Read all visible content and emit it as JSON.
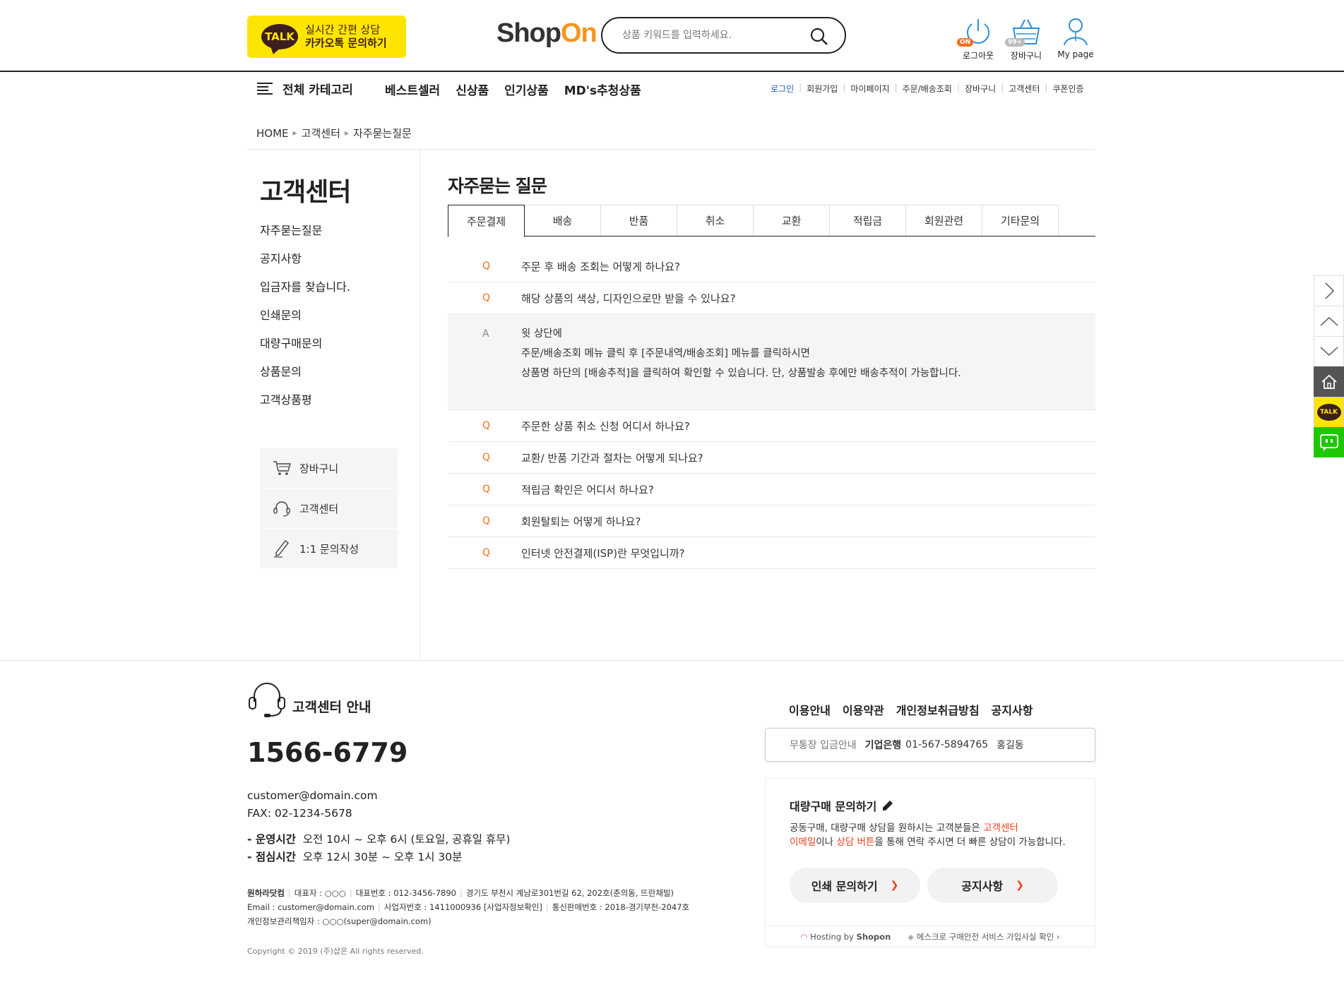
{
  "header": {
    "kakao": {
      "badge": "TALK",
      "line1": "실시간 간편 상담",
      "line2": "카카오톡 문의하기"
    },
    "logo": {
      "part1": "Shop",
      "part2": "On"
    },
    "search": {
      "placeholder": "상품 키워드를 입력하세요."
    },
    "icons": {
      "logout": {
        "label": "로그아웃",
        "badge": "ON"
      },
      "cart": {
        "label": "장바구니",
        "badge": "99+"
      },
      "mypage": {
        "label": "My page"
      }
    }
  },
  "nav": {
    "all_category": "전체 카테고리",
    "main": [
      "베스트셀러",
      "신상품",
      "인기상품",
      "MD's추청상품"
    ],
    "util": [
      "로그인",
      "회원가입",
      "마이페이지",
      "주문/배송조회",
      "장바구니",
      "고객센터",
      "쿠폰인증"
    ]
  },
  "breadcrumb": [
    "HOME",
    "고객센터",
    "자주묻는질문"
  ],
  "sidebar": {
    "title": "고객센터",
    "menu": [
      "자주묻는질문",
      "공지사항",
      "입금자를 찾습니다.",
      "인쇄문의",
      "대량구매문의",
      "상품문의",
      "고객상품평"
    ],
    "box": [
      "장바구니",
      "고객센터",
      "1:1 문의작성"
    ]
  },
  "faq": {
    "title": "자주묻는 질문",
    "tabs": [
      "주문결제",
      "배송",
      "반품",
      "취소",
      "교환",
      "적립금",
      "회원관련",
      "기타문의"
    ],
    "q_marker": "Q",
    "a_marker": "A",
    "items_before": [
      "주문 후 배송 조회는 어떻게 하나요?",
      "해당 상품의 색상, 디자인으로만 받을 수 있나요?"
    ],
    "answer": [
      "윗 상단에",
      "주문/배송조회 메뉴 클릭 후 [주문내역/배송조회] 메뉴를 클릭하시면",
      "상품명 하단의 [배송추적]을 클릭하여 확인할 수 있습니다. 단, 상품발송 후에만 배송추적이 가능합니다."
    ],
    "items_after": [
      "주문한 상품 취소 신청 어디서 하나요?",
      "교환/ 반품 기간과 절차는 어떻게 되나요?",
      "적립금 확인은 어디서 하나요?",
      "회원탈퇴는 어떻게 하나요?",
      "인터넷 안전결제(ISP)란 무엇입니까?"
    ]
  },
  "footer": {
    "cs_title": "고객센터 안내",
    "phone": "1566-6779",
    "email": "customer@domain.com",
    "fax": "FAX: 02-1234-5678",
    "hours1_label": "- 운영시간",
    "hours1": "오전 10시 ~ 오후 6시 (토요일, 공휴일 휴무)",
    "hours2_label": "- 점심시간",
    "hours2": "오후 12시 30분 ~ 오후 1시 30분",
    "company": {
      "row1": [
        "원하라닷컴",
        "대표자 : ○○○",
        "대표번호 : 012-3456-7890",
        "경기도 부천시 계남로301번길 62, 202호(춘의동, 뜨란채빌)"
      ],
      "row2": [
        "Email : customer@domain.com",
        "사업자번호 : 1411000936 [사업자정보확인]",
        "통신판매번호 : 2018-경기부천-2047호"
      ],
      "row3": "개인정보관리책임자 : ○○○(super@domain.com)"
    },
    "copyright": "Copyright © 2019 (주)샵온 All rights reserved.",
    "links": [
      "이용안내",
      "이용약관",
      "개인정보취급방침",
      "공지사항"
    ],
    "bank": {
      "label": "무통장 입금안내",
      "bank": "기업은행",
      "account": "01-567-5894765",
      "holder": "홍길동"
    },
    "bulk": {
      "title": "대량구매 문의하기",
      "desc1": "공동구매, 대량구매 상담을 원하시는 고객분들은 ",
      "desc_red1": "고객센터",
      "desc_red2": "이메일",
      "desc2": "이나 ",
      "desc_red3": "상담 버튼",
      "desc3": "을 통해 연락 주시면 더 빠른 상담이 가능합니다.",
      "btn_print": "인쇄 문의하기",
      "btn_notice": "공지사항",
      "hosting_prefix": "Hosting by",
      "hosting_brand": "Shopon",
      "escrow": "에스크로 구매안전 서비스 가입사실 확인"
    }
  },
  "quick": {
    "talk": "TALK"
  },
  "colors": {
    "accent": "#f26d21",
    "kakao": "#fee500",
    "naver": "#1ec800",
    "login_blue": "#1a5bb3"
  }
}
